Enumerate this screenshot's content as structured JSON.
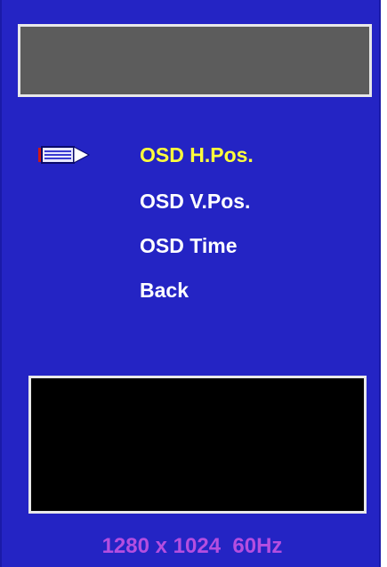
{
  "osd": {
    "menu_items": [
      {
        "label": "OSD H.Pos.",
        "selected": true
      },
      {
        "label": "OSD V.Pos.",
        "selected": false
      },
      {
        "label": "OSD Time",
        "selected": false
      },
      {
        "label": "Back",
        "selected": false
      }
    ],
    "cursor_icon": "pencil-pointer-icon",
    "resolution_text": "1280 x 1024  60Hz"
  },
  "colors": {
    "background": "#2424c4",
    "selected_text": "#ffff3c",
    "normal_text": "#ffffff",
    "resolution_text": "#b44ee0",
    "title_box": "#5c5c5c",
    "preview_box": "#000000"
  }
}
